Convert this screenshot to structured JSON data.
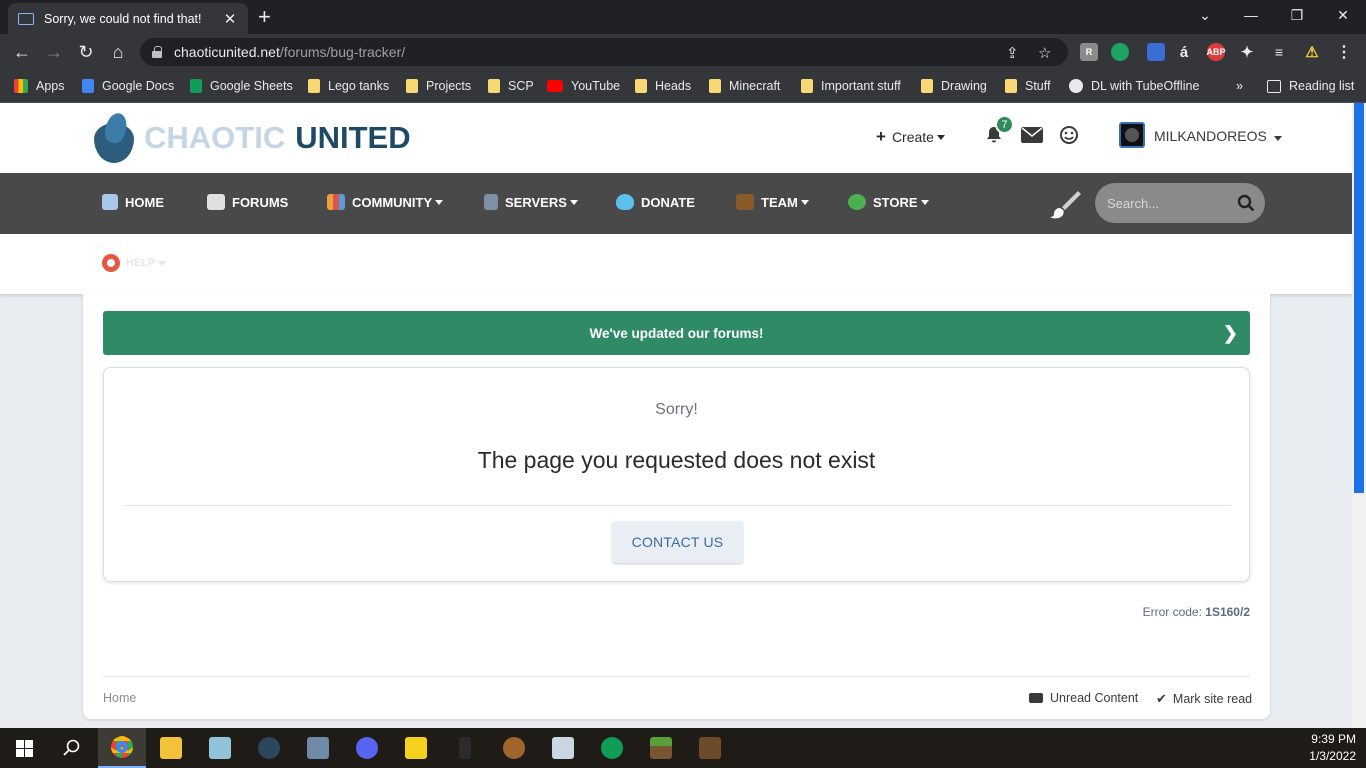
{
  "browser": {
    "tab_title": "Sorry, we could not find that!",
    "url_host": "chaoticunited.net",
    "url_path": "/forums/bug-tracker/",
    "bookmarks": [
      "Apps",
      "Google Docs",
      "Google Sheets",
      "Lego tanks",
      "Projects",
      "SCP",
      "YouTube",
      "Heads",
      "Minecraft",
      "Important stuff",
      "Drawing",
      "Stuff",
      "DL with TubeOffline"
    ],
    "more_bookmarks": "»",
    "reading_list": "Reading list",
    "ext_abp": "ABP"
  },
  "site": {
    "logo_word1": "CHAOTIC",
    "logo_word2": "UNITED",
    "create_label": "Create",
    "notif_count": "7",
    "username": "MILKANDOREOS",
    "nav": [
      "HOME",
      "FORUMS",
      "COMMUNITY",
      "SERVERS",
      "DONATE",
      "TEAM",
      "STORE"
    ],
    "search_placeholder": "Search...",
    "help_label": "HELP"
  },
  "main": {
    "notice": "We've updated our forums!",
    "sorry": "Sorry!",
    "message": "The page you requested does not exist",
    "contact_button": "CONTACT US",
    "error_code_label": "Error code:",
    "error_code": "1S160/2",
    "breadcrumb_home": "Home",
    "unread_content": "Unread Content",
    "mark_site_read": "Mark site read"
  },
  "taskbar": {
    "time": "9:39 PM",
    "date": "1/3/2022"
  },
  "colors": {
    "notice_green": "#2e8b65",
    "navbar": "#494949",
    "logo_dark": "#1f4a66",
    "contact_text": "#3a6d99"
  }
}
